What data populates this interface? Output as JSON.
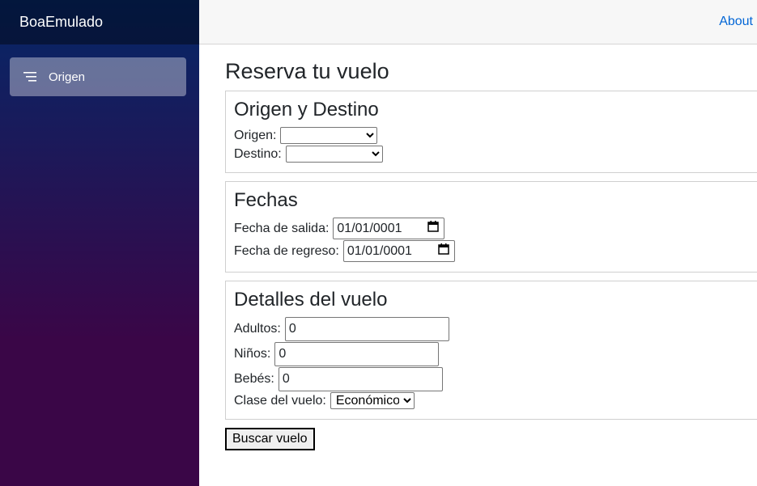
{
  "sidebar": {
    "brand": "BoaEmulado",
    "items": [
      {
        "label": "Origen",
        "icon": "list-icon"
      }
    ]
  },
  "top_row": {
    "about_label": "About"
  },
  "page": {
    "title": "Reserva tu vuelo"
  },
  "origin_destination": {
    "heading": "Origen y Destino",
    "origin_label": "Origen:",
    "origin_value": "",
    "destination_label": "Destino:",
    "destination_value": ""
  },
  "dates": {
    "heading": "Fechas",
    "departure_label": "Fecha de salida:",
    "departure_value": "01/01/0001",
    "return_label": "Fecha de regreso:",
    "return_value": "01/01/0001"
  },
  "flight_details": {
    "heading": "Detalles del vuelo",
    "adults_label": "Adultos:",
    "adults_value": "0",
    "children_label": "Niños:",
    "children_value": "0",
    "infants_label": "Bebés:",
    "infants_value": "0",
    "class_label": "Clase del vuelo:",
    "class_value": "Económico"
  },
  "actions": {
    "search_label": "Buscar vuelo"
  }
}
